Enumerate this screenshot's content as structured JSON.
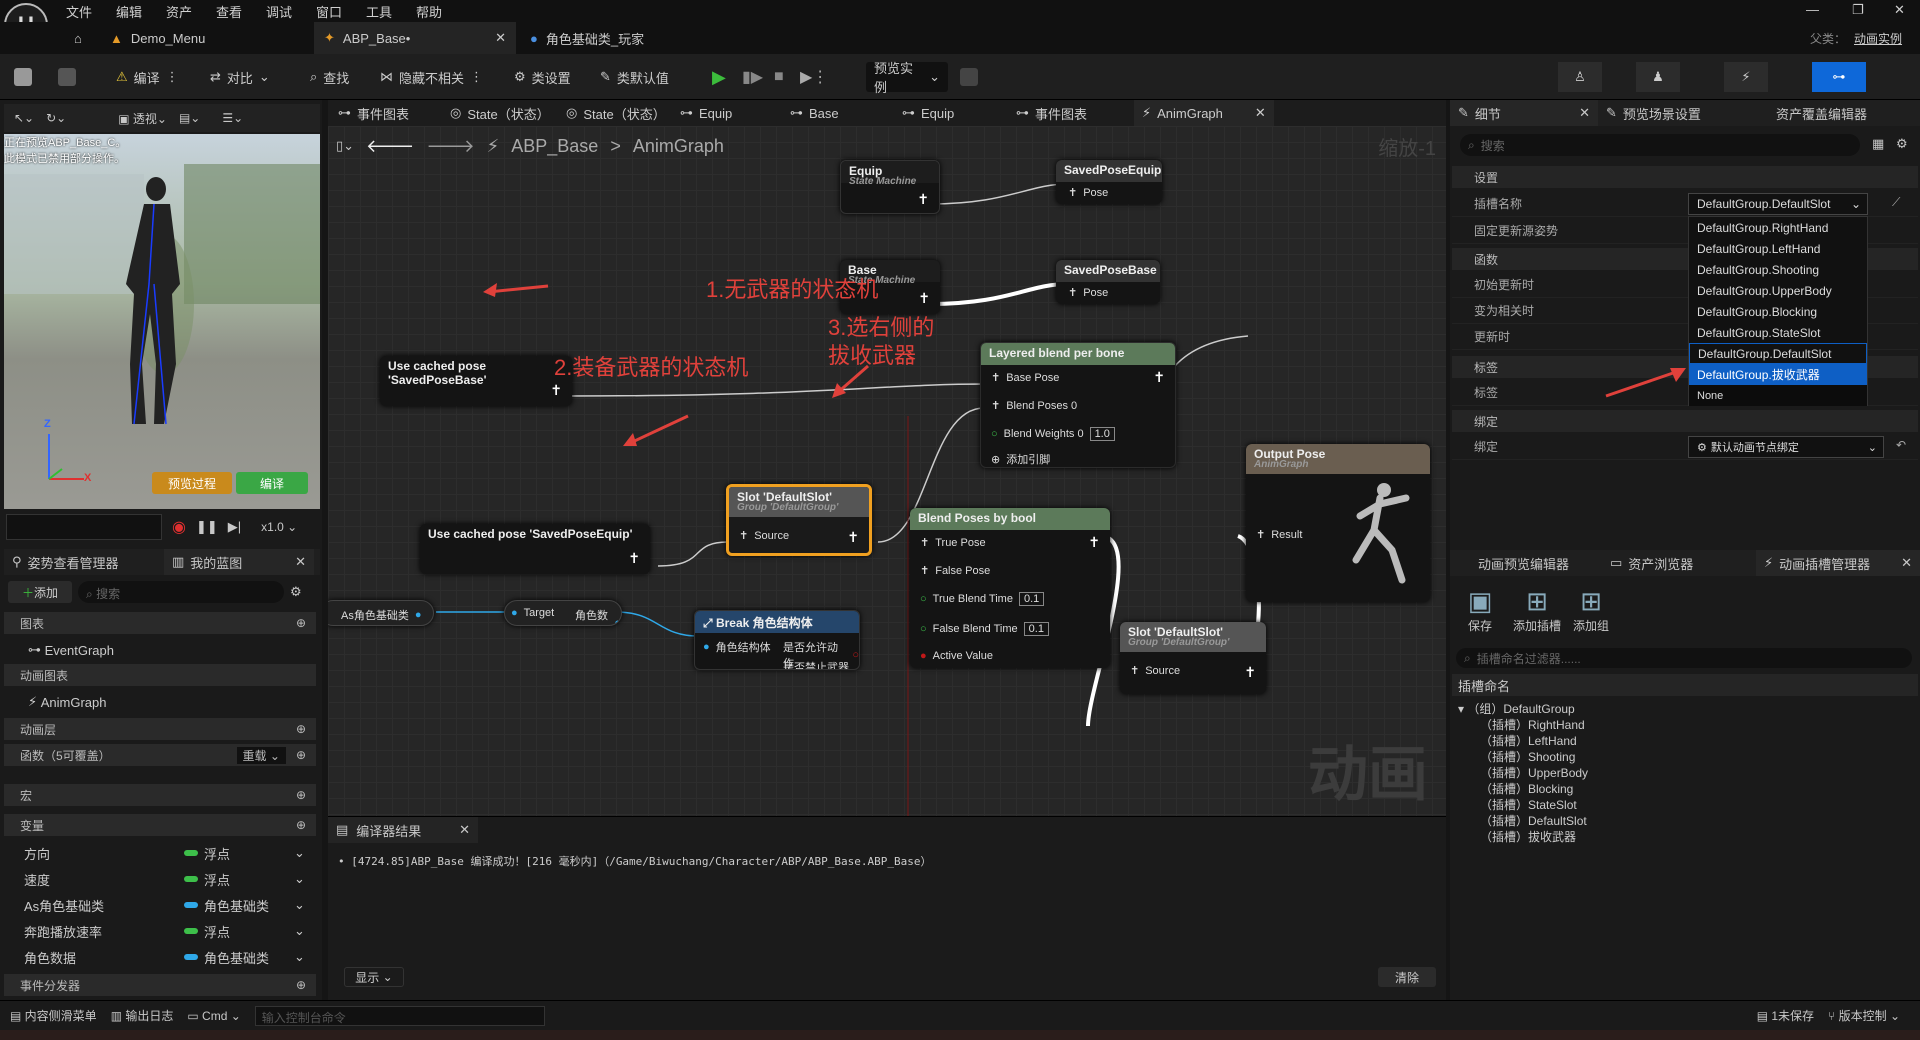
{
  "menu": {
    "items": [
      "文件",
      "编辑",
      "资产",
      "查看",
      "调试",
      "窗口",
      "工具",
      "帮助"
    ],
    "parent_label": "父类：",
    "parent_value": "动画实例"
  },
  "tabs": {
    "demo": "Demo_Menu",
    "abp": "ABP_Base•",
    "player": "角色基础类_玩家"
  },
  "toolbar": {
    "compile": "编译",
    "diff": "对比",
    "find": "查找",
    "hide": "隐藏不相关",
    "classsettings": "类设置",
    "classdefaults": "类默认值",
    "preview": "预览实例"
  },
  "viewport": {
    "tool_perspective": "透视",
    "warning": "正在预览ABP_Base_C。\n此模式已禁用部分操作。",
    "preview_flow": "预览过程",
    "compile": "编译",
    "speed": "x1.0",
    "axis_z": "Z",
    "axis_x": "X"
  },
  "leftpanel": {
    "tab_pose": "姿势查看管理器",
    "tab_blueprint": "我的蓝图",
    "add": "添加",
    "search_placeholder": "搜索",
    "graphs": "图表",
    "eventgraph": "EventGraph",
    "animgraph_hdr": "动画图表",
    "animgraph": "AnimGraph",
    "animlayer": "动画层",
    "functions": "函数（5可覆盖）",
    "override": "重载",
    "macros": "宏",
    "variables": "变量",
    "dispatchers": "事件分发器",
    "vars": [
      {
        "name": "方向",
        "type": "浮点",
        "color": "#3dbf4a"
      },
      {
        "name": "速度",
        "type": "浮点",
        "color": "#3dbf4a"
      },
      {
        "name": "As角色基础类",
        "type": "角色基础类",
        "color": "#2fa8e8"
      },
      {
        "name": "奔跑播放速率",
        "type": "浮点",
        "color": "#3dbf4a"
      },
      {
        "name": "角色数据",
        "type": "角色基础类",
        "color": "#2fa8e8"
      }
    ]
  },
  "graphtabs": [
    "事件图表",
    "State（状态）",
    "State（状态）",
    "Equip",
    "Base",
    "Equip",
    "事件图表",
    "AnimGraph"
  ],
  "breadcrumb": {
    "bp": "ABP_Base",
    "graph": "AnimGraph",
    "zoom": "缩放-1"
  },
  "nodes": {
    "equip": {
      "title": "Equip",
      "sub": "State Machine"
    },
    "savedposeequip": {
      "title": "SavedPoseEquip",
      "pin": "Pose"
    },
    "base": {
      "title": "Base",
      "sub": "State Machine"
    },
    "savedposebase": {
      "title": "SavedPoseBase",
      "pin": "Pose"
    },
    "usebase": {
      "title": "Use cached pose 'SavedPoseBase'"
    },
    "useequip": {
      "title": "Use cached pose 'SavedPoseEquip'"
    },
    "layered": {
      "title": "Layered blend per bone",
      "basepose": "Base Pose",
      "blendposes": "Blend Poses 0",
      "weights": "Blend Weights 0",
      "weights_val": "1.0",
      "addpin": "添加引脚"
    },
    "slot1": {
      "title": "Slot 'DefaultSlot'",
      "sub": "Group 'DefaultGroup'",
      "pin": "Source"
    },
    "blendbool": {
      "title": "Blend Poses by bool",
      "truepose": "True Pose",
      "falsepose": "False Pose",
      "trueblend": "True Blend Time",
      "trueval": "0.1",
      "falseblend": "False Blend Time",
      "falseval": "0.1",
      "active": "Active Value"
    },
    "slot2": {
      "title": "Slot 'DefaultSlot'",
      "sub": "Group 'DefaultGroup'",
      "pin": "Source"
    },
    "output": {
      "title": "Output Pose",
      "sub": "AnimGraph",
      "pin": "Result"
    },
    "asvar": {
      "title": "As角色基础类"
    },
    "target": {
      "target": "Target",
      "out": "角色数据"
    },
    "break": {
      "title": "Break 角色结构体",
      "in": "角色结构体",
      "out1": "是否允许动作",
      "out2": "是否禁止武器"
    }
  },
  "annotations": {
    "a1": "1.无武器的状态机",
    "a2": "2.装备武器的状态机",
    "a3a": "3.选右侧的",
    "a3b": "拔收武器"
  },
  "watermark": "动画",
  "compiler": {
    "tab": "编译器结果",
    "log": "[4724.85]ABP_Base 编译成功！[216 毫秒内]（/Game/Biwuchang/Character/ABP/ABP_Base.ABP_Base）",
    "show": "显示",
    "clear": "清除"
  },
  "details": {
    "tab_details": "细节",
    "tab_preview": "预览场景设置",
    "tab_override": "资产覆盖编辑器",
    "search": "搜索",
    "settings": "设置",
    "slotname": "插槽名称",
    "slotvalue": "DefaultGroup.DefaultSlot",
    "fixed": "固定更新源姿势",
    "functions": "函数",
    "initupdate": "初始更新时",
    "becomerelevant": "变为相关时",
    "update": "更新时",
    "tags": "标签",
    "tag": "标签",
    "binding": "绑定",
    "bind": "绑定",
    "bindvalue": "默认动画节点绑定"
  },
  "dropdown": [
    "DefaultGroup.RightHand",
    "DefaultGroup.LeftHand",
    "DefaultGroup.Shooting",
    "DefaultGroup.UpperBody",
    "DefaultGroup.Blocking",
    "DefaultGroup.StateSlot",
    "DefaultGroup.DefaultSlot",
    "DefaultGroup.拔收武器",
    "None"
  ],
  "slotmgr": {
    "tab_preview": "动画预览编辑器",
    "tab_assets": "资产浏览器",
    "tab_slots": "动画插槽管理器",
    "save": "保存",
    "addslot": "添加插槽",
    "addgroup": "添加组",
    "filter": "插槽命名过滤器......",
    "namehdr": "插槽命名",
    "group": "（组）DefaultGroup",
    "slots": [
      "（插槽）RightHand",
      "（插槽）LeftHand",
      "（插槽）Shooting",
      "（插槽）UpperBody",
      "（插槽）Blocking",
      "（插槽）StateSlot",
      "（插槽）DefaultSlot",
      "（插槽）拔收武器"
    ]
  },
  "statusbar": {
    "drawer": "内容侧滑菜单",
    "log": "输出日志",
    "cmd": "Cmd",
    "console": "输入控制台命令",
    "unsaved": "1未保存",
    "vc": "版本控制"
  }
}
